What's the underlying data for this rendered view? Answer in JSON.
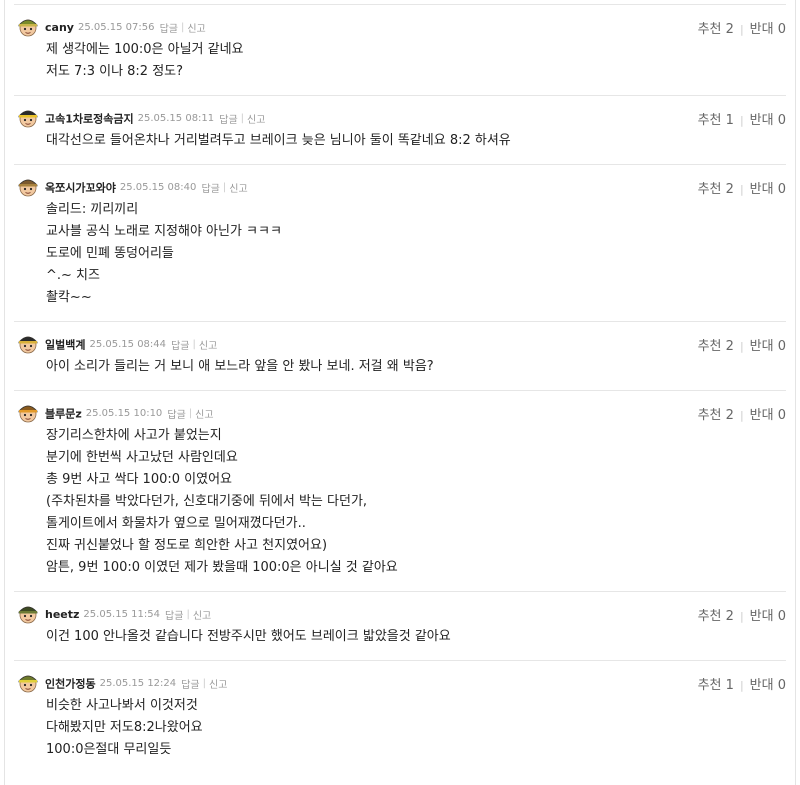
{
  "labels": {
    "reply": "답글",
    "report": "신고",
    "up": "추천",
    "down": "반대"
  },
  "comments": [
    {
      "nick": "cany",
      "date": "25.05.15 07:56",
      "up": "2",
      "down": "0",
      "avatar": "green-helmet-avatar-icon",
      "lines": [
        "제 생각에는 100:0은 아닐거 같네요",
        "저도 7:3 이나 8:2 정도?"
      ]
    },
    {
      "nick": "고속1차로정속금지",
      "date": "25.05.15 08:11",
      "up": "1",
      "down": "0",
      "avatar": "yellow-helmet-avatar-icon",
      "lines": [
        "대각선으로 들어온차나 거리벌려두고 브레이크 늦은 님니아 둘이 똑같네요 8:2 하셔유"
      ]
    },
    {
      "nick": "옥쪼시가꼬와야",
      "date": "25.05.15 08:40",
      "up": "2",
      "down": "0",
      "avatar": "brown-helmet-avatar-icon",
      "lines": [
        "솔리드: 끼리끼리",
        "교사블 공식 노래로 지정해야 아닌가 ㅋㅋㅋ",
        "도로에 민폐 똥덩어리들",
        "^.~ 치즈",
        "촬칵~~"
      ]
    },
    {
      "nick": "일벌백계",
      "date": "25.05.15 08:44",
      "up": "2",
      "down": "0",
      "avatar": "black-helmet-avatar-icon",
      "lines": [
        "아이 소리가 들리는 거 보니 애 보느라 앞을 안 봤나 보네. 저걸 왜 박음?"
      ]
    },
    {
      "nick": "블루문z",
      "date": "25.05.15 10:10",
      "up": "2",
      "down": "0",
      "avatar": "orange-helmet-avatar-icon",
      "lines": [
        "장기리스한차에 사고가 붙었는지",
        "분기에 한번씩 사고났던 사람인데요",
        "총 9번 사고 싹다 100:0 이였어요",
        "(주차된차를 박았다던가, 신호대기중에 뒤에서 박는 다던가,",
        "톨게이트에서 화물차가 옆으로 밀어재꼈다던가..",
        "진짜 귀신붙었나 할 정도로 희안한 사고 천지였어요)",
        "암튼, 9번 100:0 이였던 제가 봤을때 100:0은 아니실 것 같아요"
      ]
    },
    {
      "nick": "heetz",
      "date": "25.05.15 11:54",
      "up": "2",
      "down": "0",
      "avatar": "dark-green-helmet-avatar-icon",
      "lines": [
        "이건 100 안나올것 같습니다 전방주시만 했어도 브레이크 밟았을것 같아요"
      ]
    },
    {
      "nick": "인천가정동",
      "date": "25.05.15 12:24",
      "up": "1",
      "down": "0",
      "avatar": "striped-helmet-avatar-icon",
      "lines": [
        "비슷한 사고나봐서 이것저것",
        "다해봤지만 저도8:2나왔어요",
        "100:0은절대 무리일듯"
      ]
    }
  ]
}
